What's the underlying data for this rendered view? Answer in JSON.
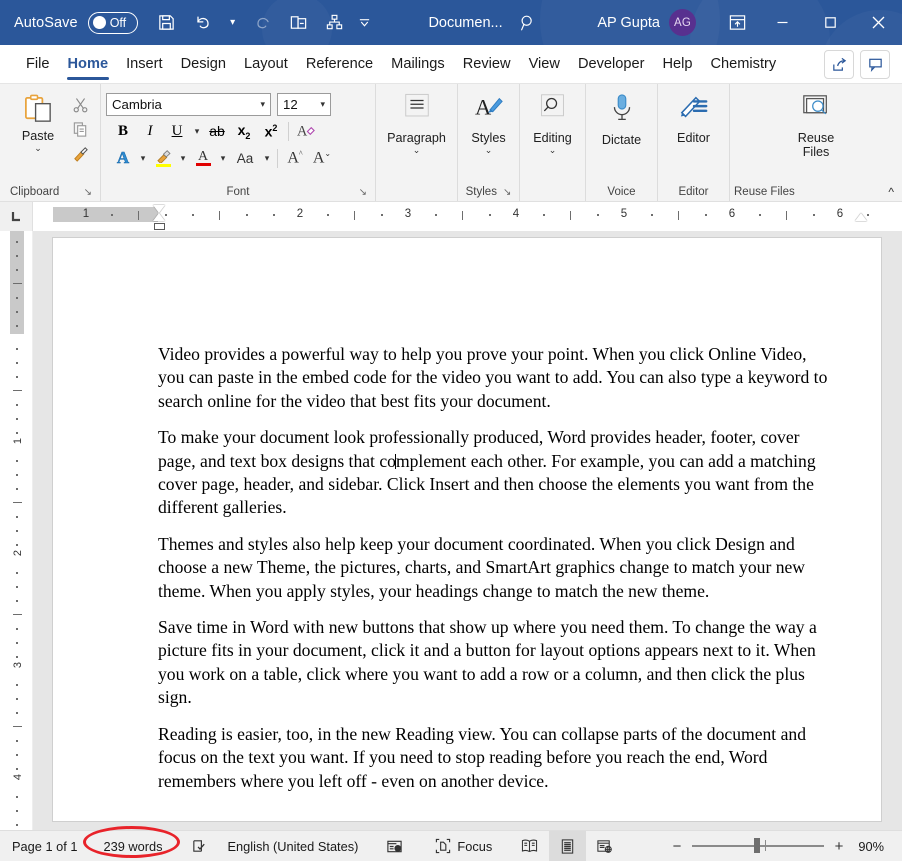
{
  "titlebar": {
    "autosave_label": "AutoSave",
    "autosave_state": "Off",
    "save_icon": "save-icon",
    "undo_icon": "undo-icon",
    "redo_icon": "redo-icon",
    "touch_icon": "touch-mode-icon",
    "hierarchy_icon": "hierarchy-icon",
    "qat_more_icon": "chevron-down-icon",
    "document_title": "Documen...",
    "search_icon": "search-icon",
    "account_name": "AP Gupta",
    "avatar_initials": "AG",
    "ribbon_display_icon": "ribbon-display-options-icon",
    "minimize_label": "–",
    "maximize_label": "☐",
    "close_label": "✕",
    "bg_color": "#2b579a",
    "avatar_color": "#58308f"
  },
  "tabs": [
    {
      "label": "File",
      "active": false
    },
    {
      "label": "Home",
      "active": true
    },
    {
      "label": "Insert",
      "active": false
    },
    {
      "label": "Design",
      "active": false
    },
    {
      "label": "Layout",
      "active": false
    },
    {
      "label": "Reference",
      "active": false
    },
    {
      "label": "Mailings",
      "active": false
    },
    {
      "label": "Review",
      "active": false
    },
    {
      "label": "View",
      "active": false
    },
    {
      "label": "Developer",
      "active": false
    },
    {
      "label": "Help",
      "active": false
    },
    {
      "label": "Chemistry",
      "active": false
    }
  ],
  "tabbar_right": {
    "share_icon": "share-icon",
    "comments_icon": "comments-icon"
  },
  "ribbon": {
    "accent_color": "#2b579a",
    "groups": [
      {
        "name": "Clipboard",
        "label": "Clipboard",
        "dialog_launcher": "↘",
        "paste_label": "Paste",
        "paste_caret": "⌄",
        "cut_icon": "cut-scissors-icon",
        "copy_icon": "copy-icon",
        "format_painter_icon": "format-painter-icon"
      },
      {
        "name": "Font",
        "label": "Font",
        "dialog_launcher": "↘",
        "font_name": "Cambria",
        "font_size": "12",
        "caret": "⌄",
        "bold_label": "B",
        "italic_label": "I",
        "underline_label": "U",
        "strikethrough_label": "ab",
        "subscript_label": "x",
        "subscript_sup": "2",
        "superscript_label": "x",
        "superscript_sup": "2",
        "clear_formatting_icon": "clear-formatting-icon",
        "text_effects_icon": "text-effects-icon",
        "highlight_icon": "text-highlight-icon",
        "font_color_icon": "font-color-icon",
        "change_case_label": "Aa",
        "grow_font_label": "A",
        "shrink_font_label": "A",
        "highlight_color": "#ffff00",
        "font_color": "#e00000"
      },
      {
        "name": "Paragraph",
        "label": "",
        "button_label": "Paragraph",
        "caret": "⌄",
        "icon": "paragraph-lines-icon"
      },
      {
        "name": "Styles",
        "label": "Styles",
        "dialog_launcher": "↘",
        "button_label": "Styles",
        "caret": "⌄",
        "icon": "styles-brush-icon"
      },
      {
        "name": "Editing",
        "label": "",
        "button_label": "Editing",
        "caret": "⌄",
        "icon": "search-magnifier-icon"
      },
      {
        "name": "Voice",
        "label": "Voice",
        "button_label": "Dictate",
        "icon": "microphone-icon"
      },
      {
        "name": "Editor",
        "label": "Editor",
        "button_label": "Editor",
        "icon": "editor-pen-icon"
      },
      {
        "name": "ReuseFiles",
        "label": "Reuse Files",
        "button_label": "Reuse Files",
        "icon": "reuse-files-icon"
      }
    ],
    "collapse_icon": "chevron-up-icon"
  },
  "ruler": {
    "corner_icon": "tab-stop-left-icon",
    "horizontal_numbers": [
      "1",
      "1",
      "2",
      "3",
      "4",
      "5",
      "6"
    ],
    "vertical_numbers": [
      "1",
      "2",
      "3",
      "4"
    ],
    "left_indent_marker": "indent-marker",
    "right_indent_marker": "indent-marker"
  },
  "document": {
    "paragraphs": [
      {
        "id": "p1",
        "text": "Video provides a powerful way to help you prove your point. When you click Online Video, you can paste in the embed code for the video you want to add. You can also type a keyword to search online for the video that best fits your document."
      },
      {
        "id": "p2",
        "text_before_caret": "To make your document look professionally produced, Word provides header, footer, cover page, and text box designs that co",
        "text_after_caret": "mplement each other. For example, you can add a matching cover page, header, and sidebar. Click Insert and then choose the elements you want from the different galleries.",
        "has_caret": true
      },
      {
        "id": "p3",
        "text": "Themes and styles also help keep your document coordinated. When you click Design and choose a new Theme, the pictures, charts, and SmartArt graphics change to match your new theme. When you apply styles, your headings change to match the new theme."
      },
      {
        "id": "p4",
        "text": "Save time in Word with new buttons that show up where you need them. To change the way a picture fits in your document, click it and a button for layout options appears next to it. When you work on a table, click where you want to add a row or a column, and then click the plus sign."
      },
      {
        "id": "p5",
        "text": "Reading is easier, too, in the new Reading view. You can collapse parts of the document and focus on the text you want. If you need to stop reading before you reach the end, Word remembers where you left off - even on another device."
      }
    ]
  },
  "statusbar": {
    "page_info": "Page 1 of 1",
    "word_count": "239 words",
    "proofing_icon": "proofing-check-icon",
    "language": "English (United States)",
    "accessibility_icon": "accessibility-icon",
    "focus_icon": "focus-mode-icon",
    "focus_label": "Focus",
    "read_mode_icon": "read-mode-icon",
    "print_layout_icon": "print-layout-icon",
    "web_layout_icon": "web-layout-icon",
    "zoom_out_label": "−",
    "zoom_in_label": "+",
    "zoom_level": "90%"
  },
  "annotation": {
    "highlight_color": "#e8232a",
    "target": "239 words"
  }
}
